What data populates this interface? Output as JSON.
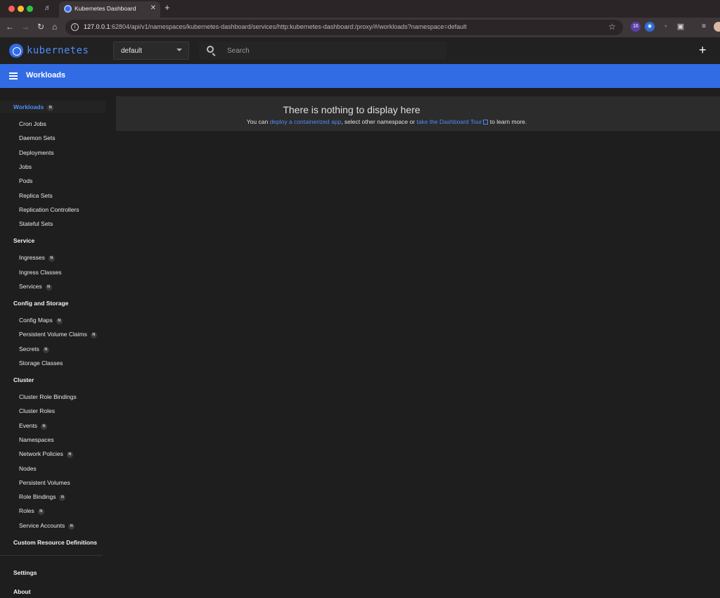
{
  "browser": {
    "tab_title": "Kubernetes Dashboard",
    "url_host": "127.0.0.1",
    "url_rest": ":62804/api/v1/namespaces/kubernetes-dashboard/services/http:kubernetes-dashboard:/proxy/#/workloads?namespace=default",
    "extension_badge": "16"
  },
  "header": {
    "logo_text": "kubernetes",
    "namespace": "default",
    "search_placeholder": "Search",
    "add_label": "+"
  },
  "titlebar": {
    "title": "Workloads"
  },
  "sidebar": {
    "workloads": {
      "label": "Workloads",
      "badge": "N"
    },
    "workload_items": [
      {
        "label": "Cron Jobs"
      },
      {
        "label": "Daemon Sets"
      },
      {
        "label": "Deployments"
      },
      {
        "label": "Jobs"
      },
      {
        "label": "Pods"
      },
      {
        "label": "Replica Sets"
      },
      {
        "label": "Replication Controllers"
      },
      {
        "label": "Stateful Sets"
      }
    ],
    "service": {
      "label": "Service"
    },
    "service_items": [
      {
        "label": "Ingresses",
        "badge": "N"
      },
      {
        "label": "Ingress Classes"
      },
      {
        "label": "Services",
        "badge": "N"
      }
    ],
    "config": {
      "label": "Config and Storage"
    },
    "config_items": [
      {
        "label": "Config Maps",
        "badge": "N"
      },
      {
        "label": "Persistent Volume Claims",
        "badge": "N"
      },
      {
        "label": "Secrets",
        "badge": "N"
      },
      {
        "label": "Storage Classes"
      }
    ],
    "cluster": {
      "label": "Cluster"
    },
    "cluster_items": [
      {
        "label": "Cluster Role Bindings"
      },
      {
        "label": "Cluster Roles"
      },
      {
        "label": "Events",
        "badge": "N"
      },
      {
        "label": "Namespaces"
      },
      {
        "label": "Network Policies",
        "badge": "N"
      },
      {
        "label": "Nodes"
      },
      {
        "label": "Persistent Volumes"
      },
      {
        "label": "Role Bindings",
        "badge": "N"
      },
      {
        "label": "Roles",
        "badge": "N"
      },
      {
        "label": "Service Accounts",
        "badge": "N"
      }
    ],
    "crd": {
      "label": "Custom Resource Definitions"
    },
    "settings": {
      "label": "Settings"
    },
    "about": {
      "label": "About"
    }
  },
  "empty_state": {
    "heading": "There is nothing to display here",
    "text_before": "You can ",
    "link_deploy": "deploy a containerized app",
    "text_middle": ", select other namespace or ",
    "link_tour": "take the Dashboard Tour",
    "text_after": " to learn more."
  }
}
